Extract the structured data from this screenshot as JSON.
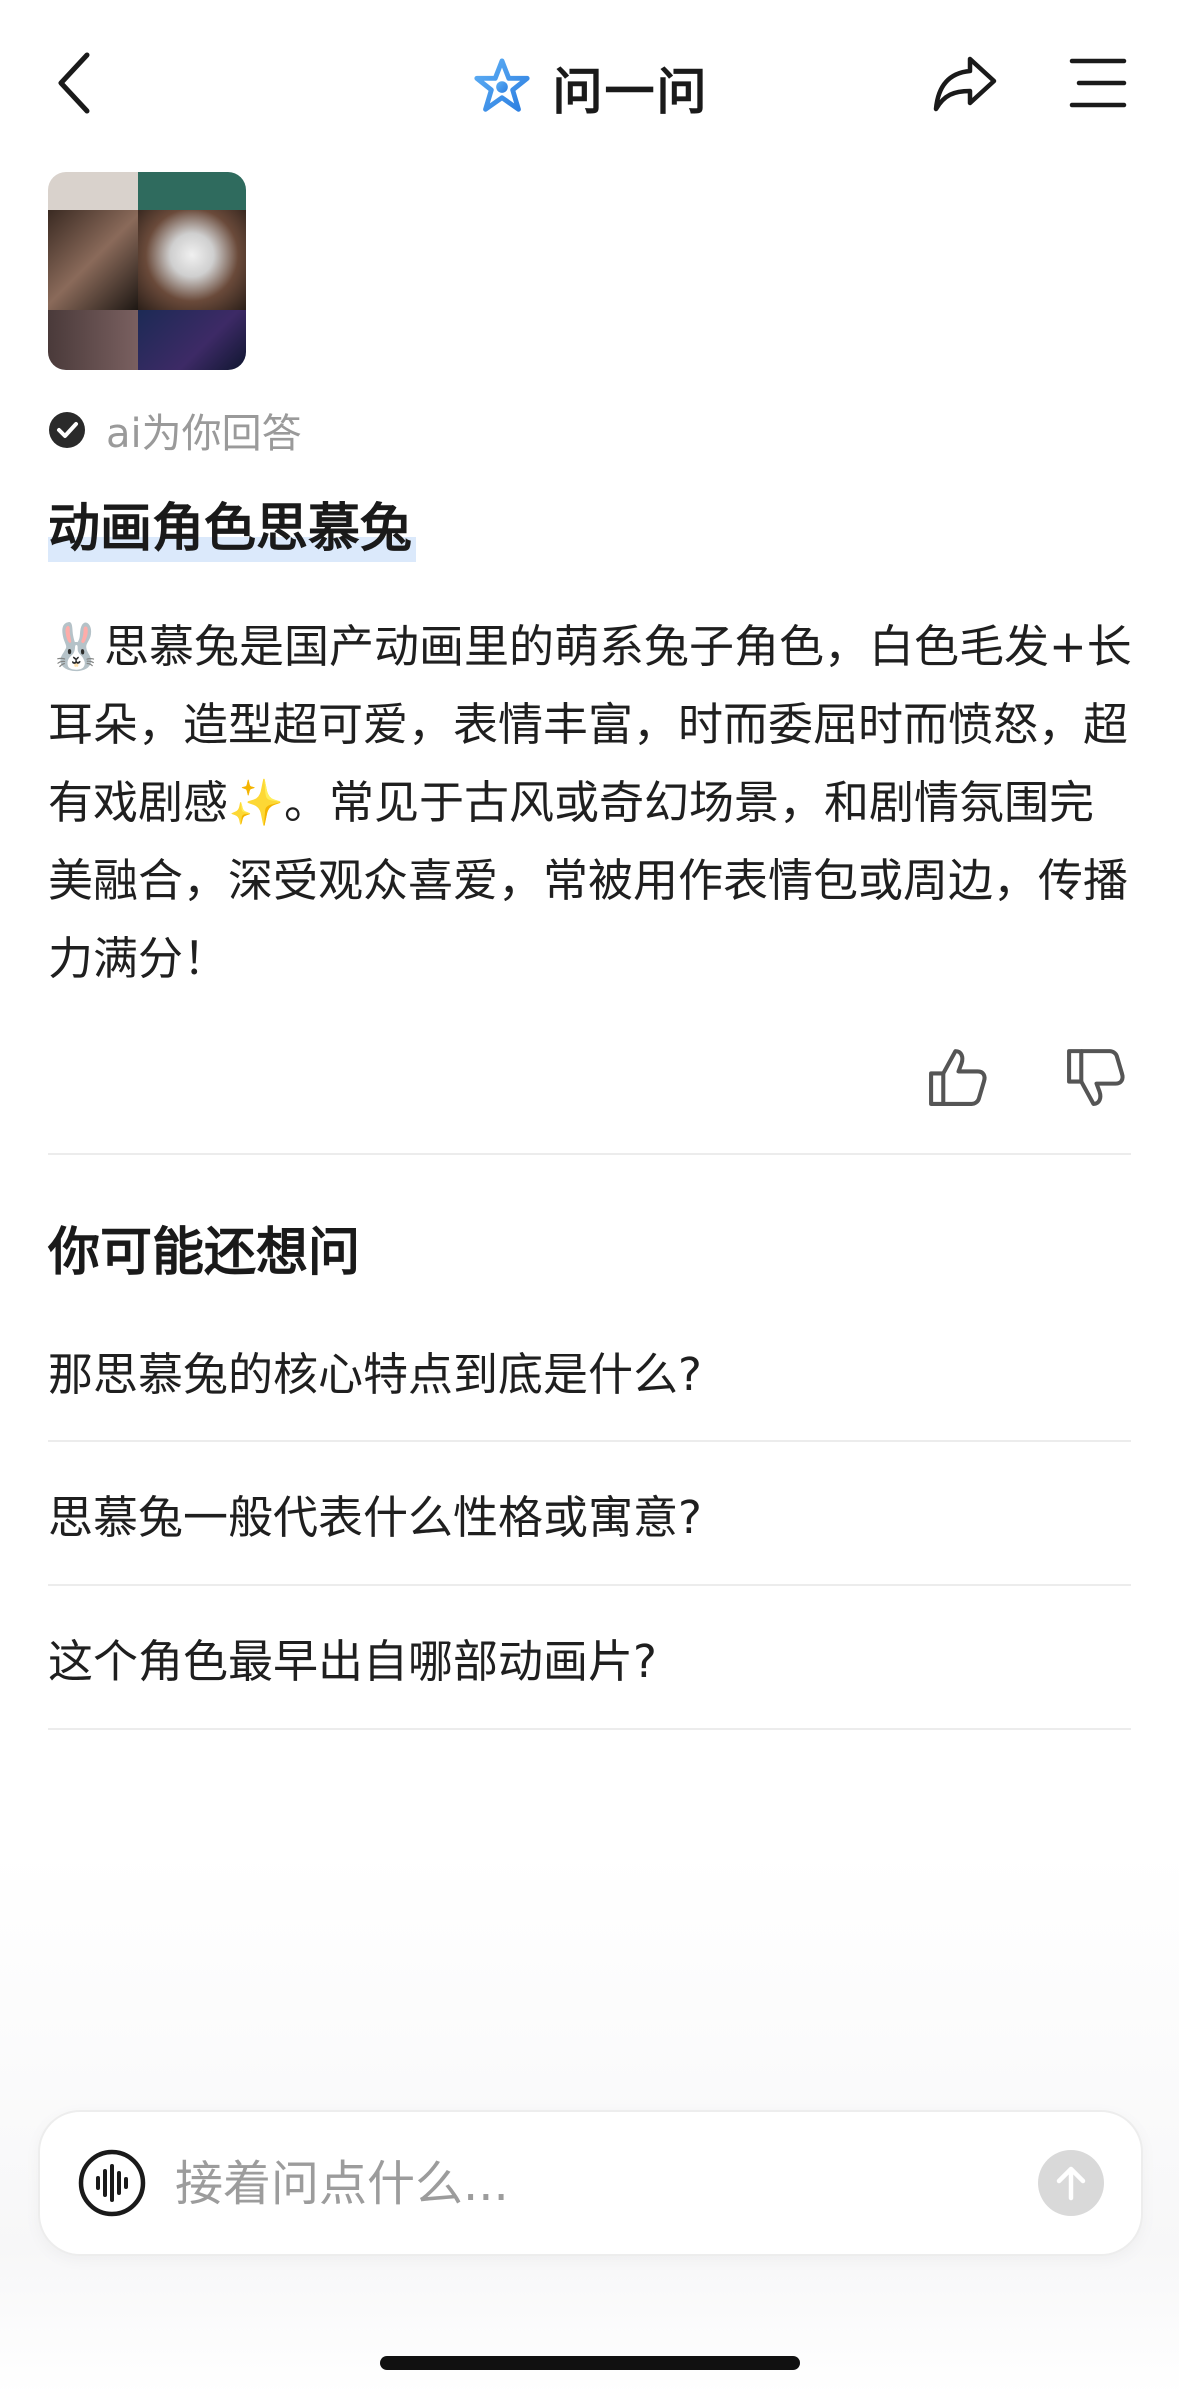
{
  "header": {
    "title": "问一问",
    "back_icon": "chevron-left-icon",
    "share_icon": "share-icon",
    "menu_icon": "menu-icon",
    "accent": "#3a8ee6"
  },
  "answer": {
    "badge": "ai为你回答",
    "title": "动画角色思慕兔",
    "body": "🐰思慕兔是国产动画里的萌系兔子角色，白色毛发+长耳朵，造型超可爱，表情丰富，时而委屈时而愤怒，超有戏剧感✨。常见于古风或奇幻场景，和剧情氛围完美融合，深受观众喜爱，常被用作表情包或周边，传播力满分！"
  },
  "feedback": {
    "like_icon": "thumbs-up-icon",
    "dislike_icon": "thumbs-down-icon"
  },
  "suggestions": {
    "title": "你可能还想问",
    "items": [
      "那思慕兔的核心特点到底是什么?",
      "思慕兔一般代表什么性格或寓意?",
      "这个角色最早出自哪部动画片?"
    ]
  },
  "input": {
    "placeholder": "接着问点什么..."
  }
}
